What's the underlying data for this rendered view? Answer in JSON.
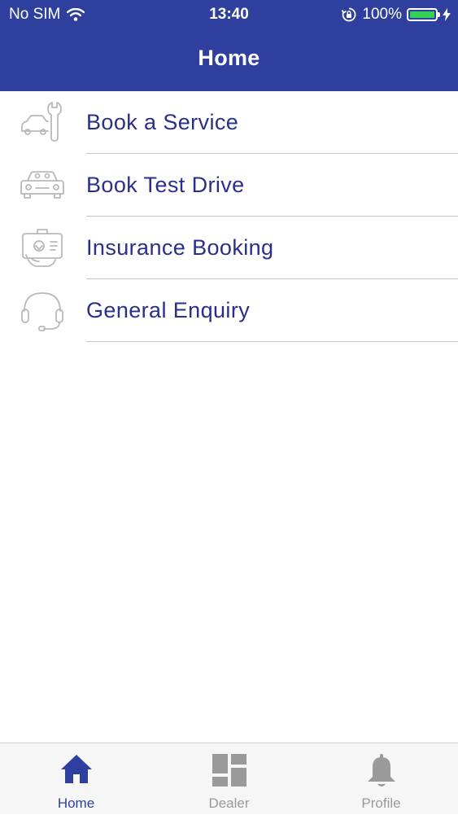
{
  "status_bar": {
    "carrier": "No SIM",
    "time": "13:40",
    "battery": "100%"
  },
  "header": {
    "title": "Home"
  },
  "menu": {
    "items": [
      {
        "label": "Book a Service",
        "icon": "car-wrench-icon"
      },
      {
        "label": "Book Test Drive",
        "icon": "car-front-icon"
      },
      {
        "label": "Insurance Booking",
        "icon": "insurance-hand-icon"
      },
      {
        "label": "General Enquiry",
        "icon": "headset-icon"
      }
    ]
  },
  "tabbar": {
    "tabs": [
      {
        "label": "Home",
        "icon": "home-icon",
        "active": true
      },
      {
        "label": "Dealer",
        "icon": "dashboard-icon",
        "active": false
      },
      {
        "label": "Profile",
        "icon": "bell-icon",
        "active": false
      }
    ]
  },
  "colors": {
    "primary": "#2f3f9e",
    "label_text": "#2a2f8a",
    "inactive_tab": "#9a9a9a",
    "battery_green": "#34d058"
  }
}
